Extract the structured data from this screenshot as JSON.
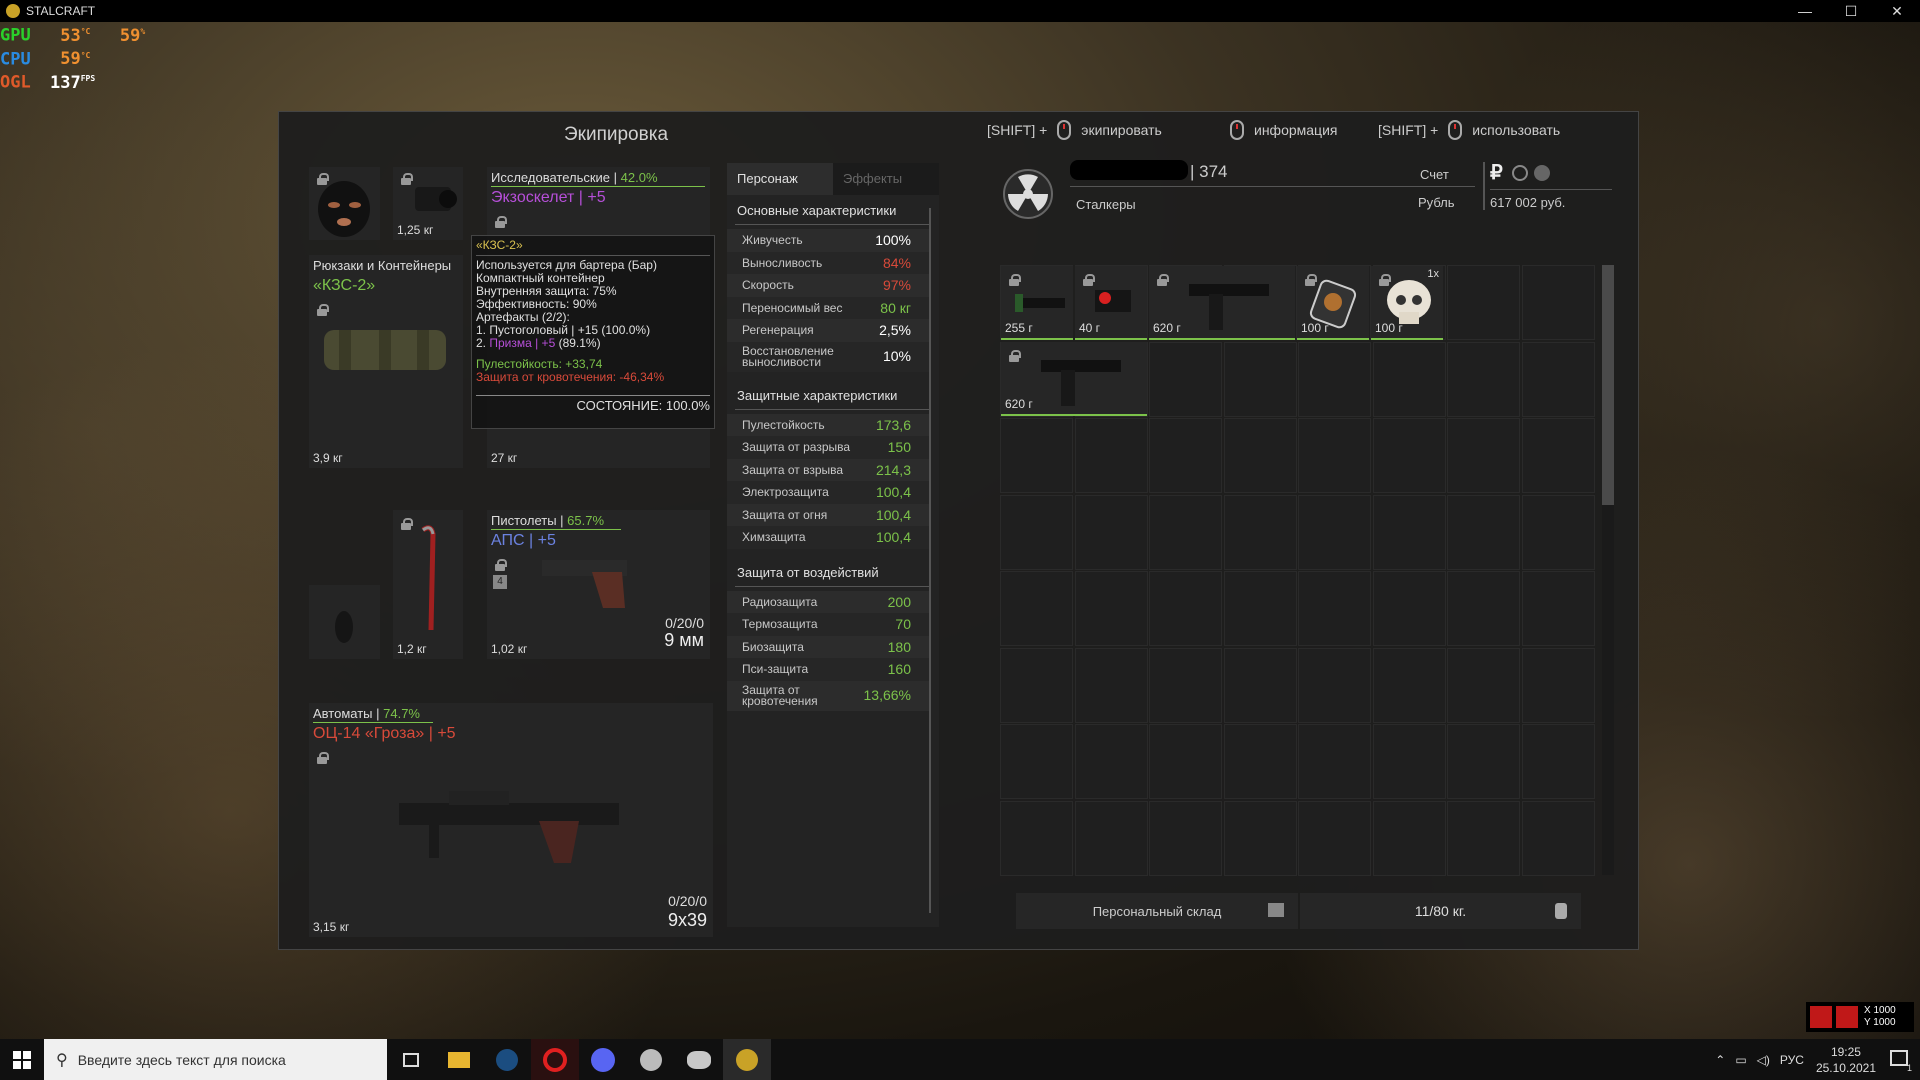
{
  "window": {
    "title": "STALCRAFT",
    "min": "—",
    "max": "☐",
    "close": "✕"
  },
  "osd": {
    "gpu_label": "GPU",
    "gpu_temp": "53",
    "gpu_temp_unit": "°C",
    "gpu_load": "59",
    "gpu_load_unit": "%",
    "cpu_label": "CPU",
    "cpu_temp": "59",
    "cpu_temp_unit": "°C",
    "ogl_label": "OGL",
    "fps": "137",
    "fps_unit": "FPS"
  },
  "equipment": {
    "title": "Экипировка",
    "helmet_cam_weight": "1,25 кг",
    "armor_header": "Исследовательские | ",
    "armor_percent": "42.0%",
    "armor_name": "Экзоскелет | +5",
    "armor_weight": "27 кг",
    "backpack_header": "Рюкзаки и Контейнеры",
    "backpack_name": "«КЗС-2»",
    "backpack_weight": "3,9 кг",
    "tool_weight": "1,2 кг",
    "pistol_header": "Пистолеты | ",
    "pistol_percent": "65.7%",
    "pistol_name": "АПС | +5",
    "pistol_ammo": "0/20/0",
    "pistol_caliber": "9 мм",
    "pistol_weight": "1,02 кг",
    "pistol_badge": "4",
    "rifle_header": "Автоматы | ",
    "rifle_percent": "74.7%",
    "rifle_name": "ОЦ-14 «Гроза» | +5",
    "rifle_ammo": "0/20/0",
    "rifle_caliber": "9х39",
    "rifle_weight": "3,15 кг"
  },
  "tooltip": {
    "title": "«КЗС-2»",
    "l1": "Используется для бартера (Бар)",
    "l2": "Компактный контейнер",
    "l3": "Внутренняя защита: 75%",
    "l4": "Эффективность: 90%",
    "l5": "Артефакты (2/2):",
    "l6": "1. Пустоголовый | +15 (100.0%)",
    "l7a": "2. ",
    "l7b": "Призма | +5",
    "l7c": " (89.1%)",
    "l8": "Пулестойкость: +33,74",
    "l9": "Защита от кровотечения: -46,34%",
    "state": "СОСТОЯНИЕ: 100.0%"
  },
  "stats": {
    "tab_character": "Персонаж",
    "tab_effects": "Эффекты",
    "main_title": "Основные характеристики",
    "main": [
      {
        "label": "Живучесть",
        "value": "100%"
      },
      {
        "label": "Выносливость",
        "value": "84%"
      },
      {
        "label": "Скорость",
        "value": "97%"
      },
      {
        "label": "Переносимый вес",
        "value": "80 кг"
      },
      {
        "label": "Регенерация",
        "value": "2,5%"
      },
      {
        "label": "Восстановление выносливости",
        "value": "10%"
      }
    ],
    "protect_title": "Защитные характеристики",
    "protect": [
      {
        "label": "Пулестойкость",
        "value": "173,6"
      },
      {
        "label": "Защита от разрыва",
        "value": "150"
      },
      {
        "label": "Защита от взрыва",
        "value": "214,3"
      },
      {
        "label": "Электрозащита",
        "value": "100,4"
      },
      {
        "label": "Защита от огня",
        "value": "100,4"
      },
      {
        "label": "Химзащита",
        "value": "100,4"
      }
    ],
    "impact_title": "Защита от воздействий",
    "impact": [
      {
        "label": "Радиозащита",
        "value": "200"
      },
      {
        "label": "Термозащита",
        "value": "70"
      },
      {
        "label": "Биозащита",
        "value": "180"
      },
      {
        "label": "Пси-защита",
        "value": "160"
      },
      {
        "label": "Защита от кровотечения",
        "value": "13,66%"
      }
    ]
  },
  "hints": {
    "shift1": "[SHIFT] +",
    "equip": "экипировать",
    "info": "информация",
    "shift2": "[SHIFT] +",
    "use": "использовать"
  },
  "profile": {
    "level": "374",
    "faction": "Сталкеры",
    "account_label": "Счет",
    "currency_label": "Рубль",
    "currency_symbol": "₽",
    "balance": "617 002 руб."
  },
  "inventory": {
    "items": [
      {
        "weight": "255 г"
      },
      {
        "weight": "40 г"
      },
      {
        "weight": "620 г"
      },
      {
        "weight": "100 г"
      },
      {
        "weight": "100 г",
        "count": "1x"
      },
      {
        "weight": "620 г"
      }
    ],
    "storage_label": "Персональный склад",
    "capacity": "11/80 кг."
  },
  "taskbar": {
    "search_placeholder": "Введите здесь текст для поиска",
    "lang": "РУС",
    "time": "19:25",
    "date": "25.10.2021",
    "coord_x": "X 1000",
    "coord_y": "Y 1000",
    "notif_count": "1"
  }
}
